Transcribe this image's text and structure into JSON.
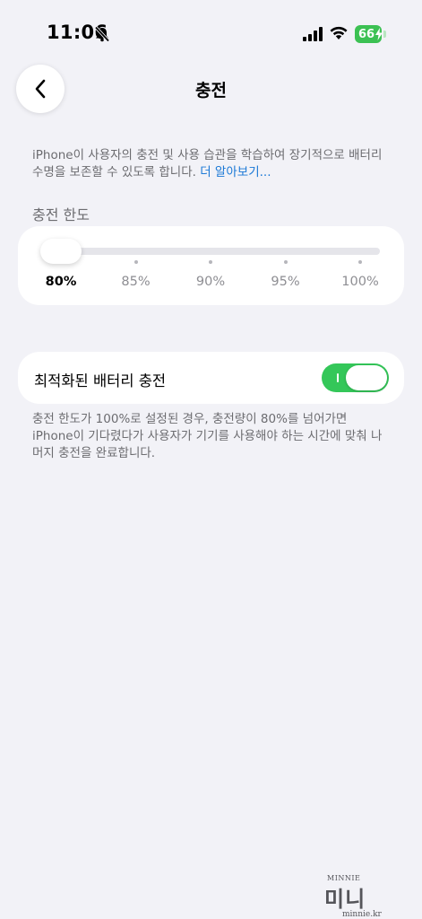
{
  "status_bar": {
    "time": "11:06",
    "battery_level": "66",
    "icons": [
      "bell-slash-icon",
      "cellular-signal-icon",
      "wifi-icon",
      "battery-charging-icon"
    ]
  },
  "nav": {
    "back_icon": "chevron-left-icon",
    "title": "충전"
  },
  "description": {
    "text": "iPhone이 사용자의 충전 및 사용 습관을 학습하여 장기적으로 배터리 수명을 보존할 수 있도록 합니다. ",
    "link": "더 알아보기..."
  },
  "charge_limit": {
    "label": "충전 한도",
    "options": [
      "80%",
      "85%",
      "90%",
      "95%",
      "100%"
    ],
    "selected": "80%",
    "selected_index": 0
  },
  "optimized_charging": {
    "label": "최적화된 배터리 충전",
    "enabled": true
  },
  "footnote": "충전 한도가 100%로 설정된 경우, 충전량이 80%를 넘어가면 iPhone이 기다렸다가 사용자가 기기를 사용해야 하는 시간에 맞춰 나머지 충전을 완료합니다.",
  "watermark": {
    "top": "MINNIE",
    "middle": "미니",
    "bottom": "minnie.kr"
  },
  "colors": {
    "background": "#f2f2f7",
    "accent_green": "#34c759",
    "link_blue": "#1a78d6"
  }
}
